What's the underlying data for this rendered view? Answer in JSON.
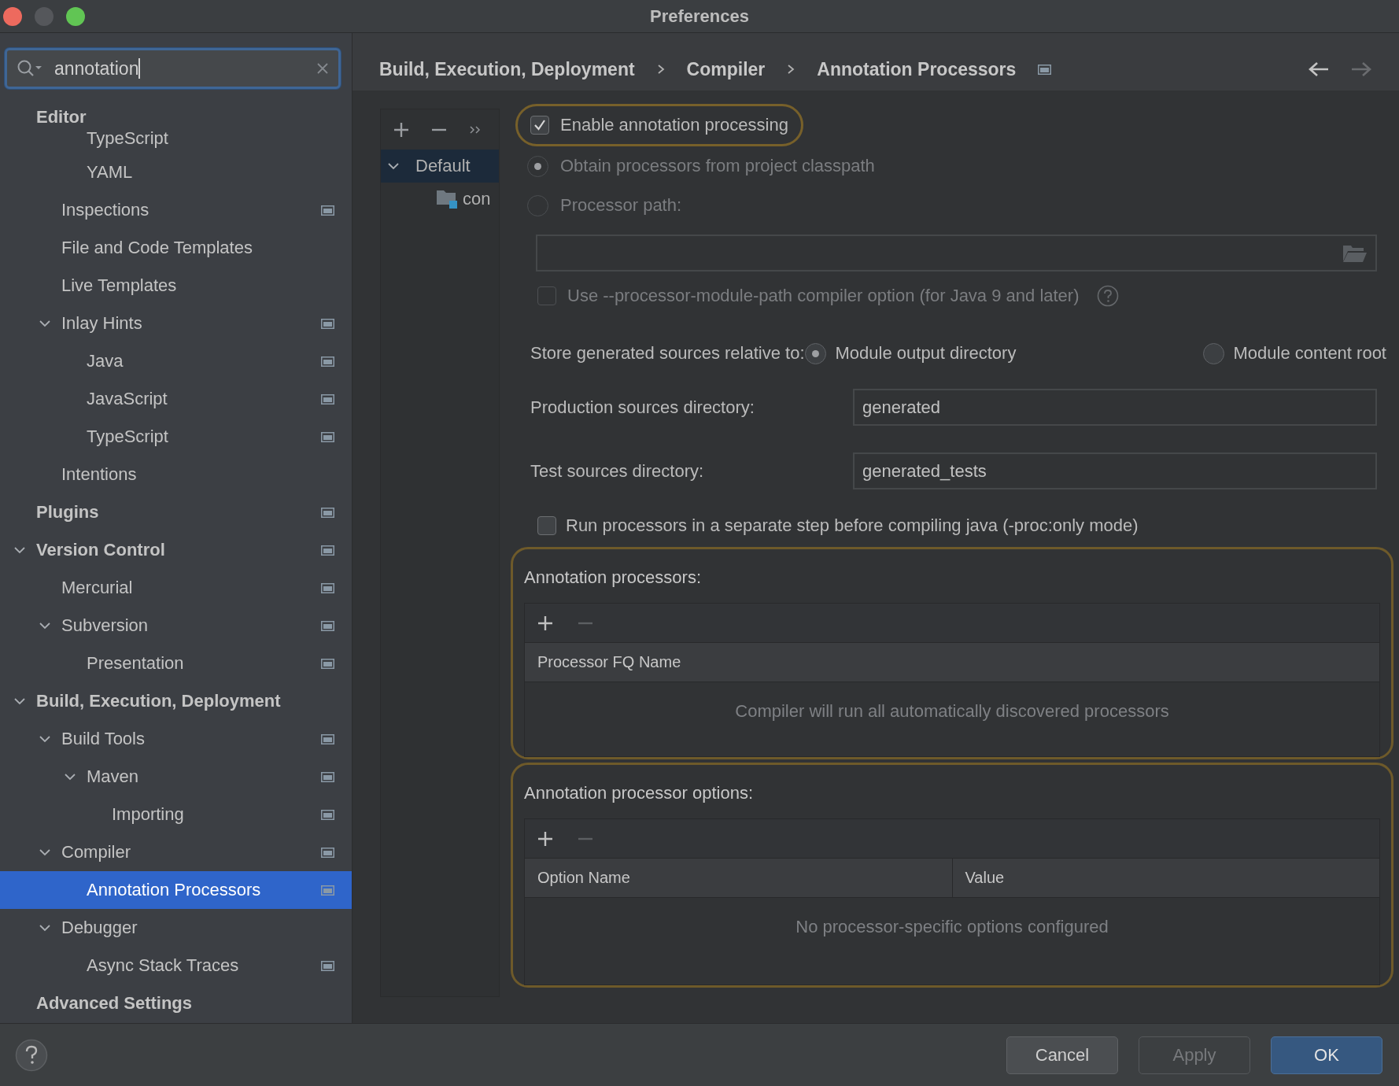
{
  "window": {
    "title": "Preferences",
    "traffic_lights": [
      {
        "color": "#ed6a5e"
      },
      {
        "color": "#55575b"
      },
      {
        "color": "#61c554"
      }
    ]
  },
  "search": {
    "value": "annotation"
  },
  "sidebar": {
    "items": [
      {
        "label": "Editor",
        "selected": false,
        "children": [
          {
            "children": [
              {
                "label": "TypeScript",
                "selected": false,
                "project_scope": false
              },
              {
                "label": "YAML",
                "selected": false,
                "project_scope": false
              }
            ]
          },
          {
            "label": "Inspections",
            "selected": false,
            "project_scope": true
          },
          {
            "label": "File and Code Templates",
            "selected": false,
            "project_scope": false
          },
          {
            "label": "Live Templates",
            "selected": false,
            "project_scope": false
          },
          {
            "label": "Inlay Hints",
            "selected": false,
            "project_scope": true,
            "expanded": true,
            "children": [
              {
                "label": "Java",
                "selected": false,
                "project_scope": true
              },
              {
                "label": "JavaScript",
                "selected": false,
                "project_scope": true
              },
              {
                "label": "TypeScript",
                "selected": false,
                "project_scope": true
              }
            ]
          },
          {
            "label": "Intentions",
            "selected": false,
            "project_scope": false
          }
        ]
      },
      {
        "label": "Plugins",
        "selected": false,
        "project_scope": true
      },
      {
        "label": "Version Control",
        "selected": false,
        "project_scope": true,
        "expanded": true,
        "children": [
          {
            "label": "Mercurial",
            "selected": false,
            "project_scope": true
          },
          {
            "label": "Subversion",
            "selected": false,
            "project_scope": true,
            "expanded": true,
            "children": [
              {
                "label": "Presentation",
                "selected": false,
                "project_scope": true
              }
            ]
          }
        ]
      },
      {
        "label": "Build, Execution, Deployment",
        "selected": false,
        "project_scope": false,
        "expanded": true,
        "children": [
          {
            "label": "Build Tools",
            "selected": false,
            "project_scope": true,
            "expanded": true,
            "children": [
              {
                "label": "Maven",
                "selected": false,
                "project_scope": true,
                "expanded": true,
                "children": [
                  {
                    "label": "Importing",
                    "selected": false,
                    "project_scope": true
                  }
                ]
              }
            ]
          },
          {
            "label": "Compiler",
            "selected": false,
            "project_scope": true,
            "expanded": true,
            "children": [
              {
                "label": "Annotation Processors",
                "selected": true,
                "project_scope": true
              }
            ]
          },
          {
            "label": "Debugger",
            "selected": false,
            "project_scope": false,
            "expanded": true,
            "children": [
              {
                "label": "Async Stack Traces",
                "selected": false,
                "project_scope": true
              }
            ]
          }
        ]
      },
      {
        "label": "Advanced Settings",
        "selected": false,
        "project_scope": false
      }
    ]
  },
  "breadcrumb": {
    "items": [
      "Build, Execution, Deployment",
      "Compiler",
      "Annotation Processors"
    ],
    "project_scope": true
  },
  "profiles": {
    "items": [
      {
        "label": "Default",
        "selected": true,
        "expanded": true,
        "children": [
          {
            "label": "con",
            "selected": false
          }
        ]
      }
    ]
  },
  "settings": {
    "enable": {
      "label": "Enable annotation processing",
      "checked": true,
      "highlighted": true
    },
    "processor_source": [
      {
        "label": "Obtain processors from project classpath",
        "selected": true,
        "disabled": true
      },
      {
        "label": "Processor path:",
        "selected": false,
        "disabled": true
      }
    ],
    "module_path_option": {
      "label": "Use --processor-module-path compiler option (for Java 9 and later)",
      "checked": false,
      "disabled": true
    },
    "store_relative": {
      "label": "Store generated sources relative to:",
      "options": [
        {
          "label": "Module output directory",
          "selected": true
        },
        {
          "label": "Module content root",
          "selected": false
        }
      ]
    },
    "production_dir": {
      "label": "Production sources directory:",
      "value": "generated"
    },
    "test_dir": {
      "label": "Test sources directory:",
      "value": "generated_tests"
    },
    "run_separately": {
      "label": "Run processors in a separate step before compiling java (-proc:only mode)",
      "checked": false,
      "disabled": false
    },
    "tables": [
      {
        "title": "Annotation processors:",
        "highlighted": true,
        "columns": [
          "Processor FQ Name"
        ],
        "empty_text": "Compiler will run all automatically discovered processors"
      },
      {
        "title": "Annotation processor options:",
        "highlighted": true,
        "columns": [
          "Option Name",
          "Value"
        ],
        "empty_text": "No processor-specific options configured"
      }
    ]
  },
  "buttons": [
    {
      "label": "Cancel",
      "kind": "normal",
      "disabled": false
    },
    {
      "label": "Apply",
      "kind": "normal",
      "disabled": true
    },
    {
      "label": "OK",
      "kind": "default",
      "disabled": false
    }
  ]
}
